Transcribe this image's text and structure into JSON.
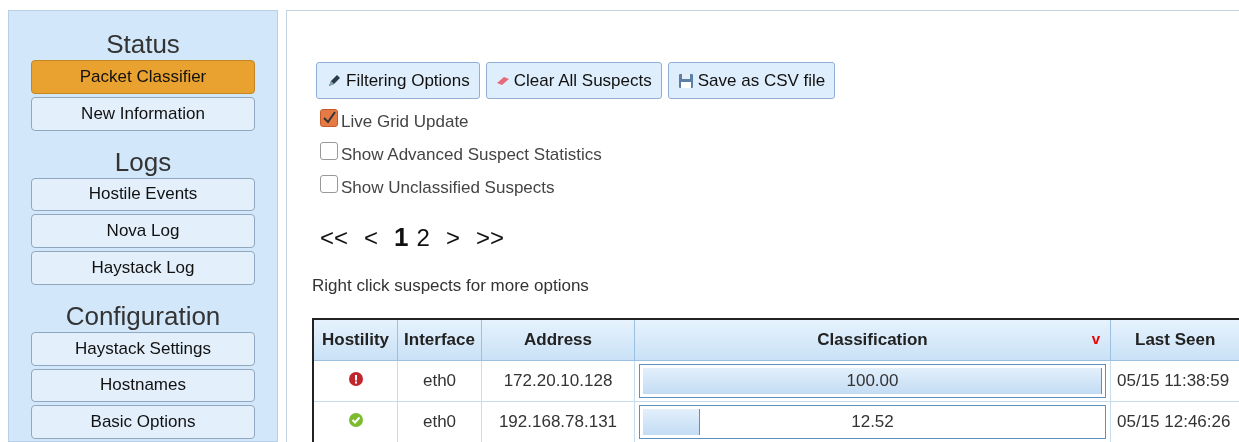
{
  "sidebar": {
    "sections": [
      {
        "heading": "Status",
        "items": [
          {
            "label": "Packet Classifier",
            "selected": true
          },
          {
            "label": "New Information",
            "selected": false
          }
        ]
      },
      {
        "heading": "Logs",
        "items": [
          {
            "label": "Hostile Events",
            "selected": false
          },
          {
            "label": "Nova Log",
            "selected": false
          },
          {
            "label": "Haystack Log",
            "selected": false
          }
        ]
      },
      {
        "heading": "Configuration",
        "items": [
          {
            "label": "Haystack Settings",
            "selected": false
          },
          {
            "label": "Hostnames",
            "selected": false
          },
          {
            "label": "Basic Options",
            "selected": false
          }
        ]
      }
    ]
  },
  "toolbar": [
    {
      "label": "Filtering Options",
      "kind": "filter"
    },
    {
      "label": "Clear All Suspects",
      "kind": "eraser"
    },
    {
      "label": "Save as CSV file",
      "kind": "save"
    }
  ],
  "options": [
    {
      "label": "Live Grid Update",
      "checked": true
    },
    {
      "label": "Show Advanced Suspect Statistics",
      "checked": false
    },
    {
      "label": "Show Unclassified Suspects",
      "checked": false
    }
  ],
  "pager": [
    {
      "label": "<<",
      "kind": "nav"
    },
    {
      "label": "<",
      "kind": "nav"
    },
    {
      "label": "1",
      "kind": "page",
      "selected": true
    },
    {
      "label": "2",
      "kind": "page",
      "selected": false
    },
    {
      "label": ">",
      "kind": "nav"
    },
    {
      "label": ">>",
      "kind": "nav"
    }
  ],
  "hint": "Right click suspects for more options",
  "table": {
    "columns": [
      {
        "label": "Hostility"
      },
      {
        "label": "Interface"
      },
      {
        "label": "Address"
      },
      {
        "label": "Classification",
        "sort": "v"
      },
      {
        "label": "Last Seen"
      }
    ],
    "rows": [
      {
        "kind": "hostile",
        "interface": "eth0",
        "address": "172.20.10.128",
        "classification": "100.00",
        "level": 1.0,
        "last_seen": "05/15 11:38:59"
      },
      {
        "kind": "benign",
        "interface": "eth0",
        "address": "192.168.78.131",
        "classification": "12.52",
        "level": 0.1252,
        "last_seen": "05/15 12:46:26"
      }
    ]
  }
}
